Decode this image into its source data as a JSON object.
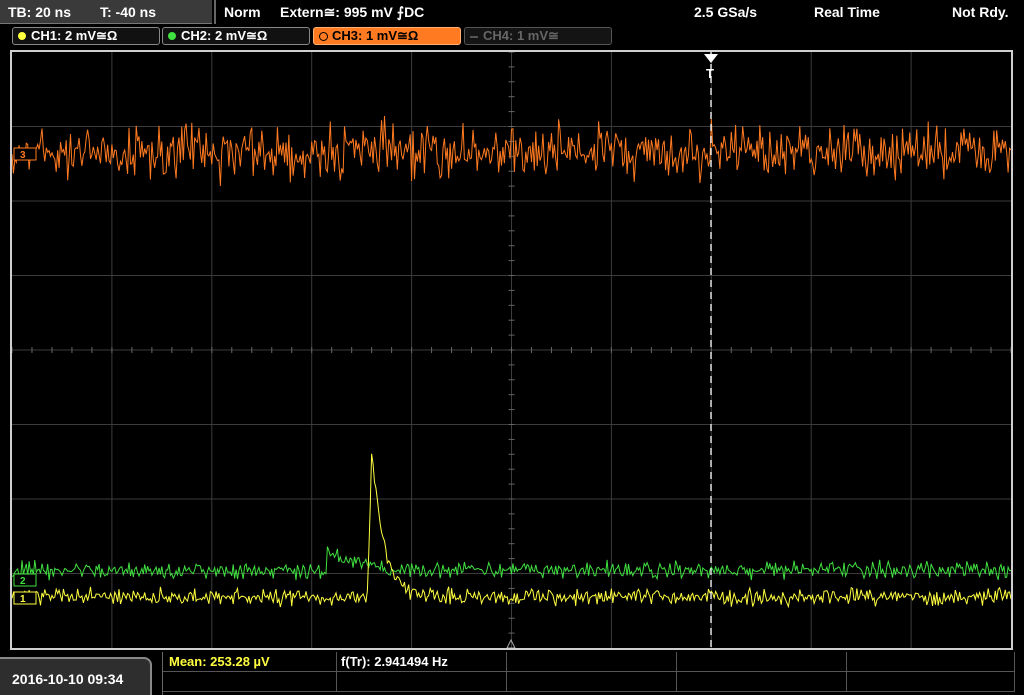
{
  "header": {
    "tb": "TB: 20 ns",
    "t": "T: -40 ns",
    "mode": "Norm",
    "trigger": "Extern≅: 995 mV ⨍DC",
    "sample_rate": "2.5 GSa/s",
    "acq_mode": "Real Time",
    "status": "Not Rdy."
  },
  "channels": [
    {
      "label": "CH1: 2 mV≅Ω",
      "color": "#ffff40",
      "active": false,
      "enabled": true
    },
    {
      "label": "CH2: 2 mV≅Ω",
      "color": "#40e040",
      "active": false,
      "enabled": true
    },
    {
      "label": "CH3: 1 mV≅Ω",
      "color": "#ff7a20",
      "active": true,
      "enabled": true
    },
    {
      "label": "CH4: 1 mV≅",
      "color": "#666666",
      "active": false,
      "enabled": false
    }
  ],
  "markers": {
    "trigger_label": "T",
    "ch3_marker": "3",
    "ch2_marker": "2",
    "ch1_marker": "1"
  },
  "footer": {
    "datetime": "2016-10-10 09:34",
    "mean_label": "Mean: 253.28 µV",
    "freq_label": "f(Tr): 2.941494 Hz"
  },
  "colors": {
    "ch1": "#ffff40",
    "ch2": "#40e040",
    "ch3": "#ff7a20",
    "grid": "#3c3c3c"
  }
}
